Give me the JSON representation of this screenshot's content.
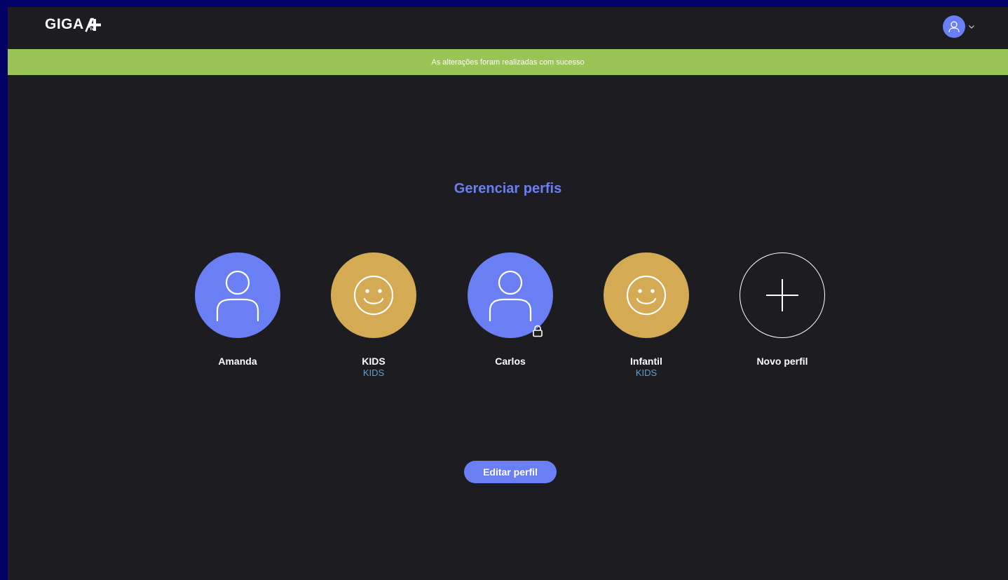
{
  "header": {
    "logo_text": "GIGA",
    "logo_sub": "tv",
    "avatar_icon": "user-icon",
    "menu_icon": "chevron-down-icon"
  },
  "banner": {
    "message": "As alterações foram realizadas com sucesso",
    "color": "#98c556"
  },
  "page": {
    "title": "Gerenciar perfis"
  },
  "profiles": [
    {
      "name": "Amanda",
      "subtitle": "",
      "type": "user",
      "color": "#6b7ff5",
      "locked": false
    },
    {
      "name": "KIDS",
      "subtitle": "KIDS",
      "type": "kids",
      "color": "#d4aa55",
      "locked": false
    },
    {
      "name": "Carlos",
      "subtitle": "",
      "type": "user",
      "color": "#6b7ff5",
      "locked": true
    },
    {
      "name": "Infantil",
      "subtitle": "KIDS",
      "type": "kids",
      "color": "#d4aa55",
      "locked": false
    },
    {
      "name": "Novo perfil",
      "subtitle": "",
      "type": "add",
      "color": "#ffffff",
      "locked": false
    }
  ],
  "actions": {
    "edit_label": "Editar perfil"
  },
  "colors": {
    "accent": "#6b7ff5",
    "background": "#1d1c21",
    "frame": "#000066",
    "kids_label": "#5aa0d6"
  }
}
